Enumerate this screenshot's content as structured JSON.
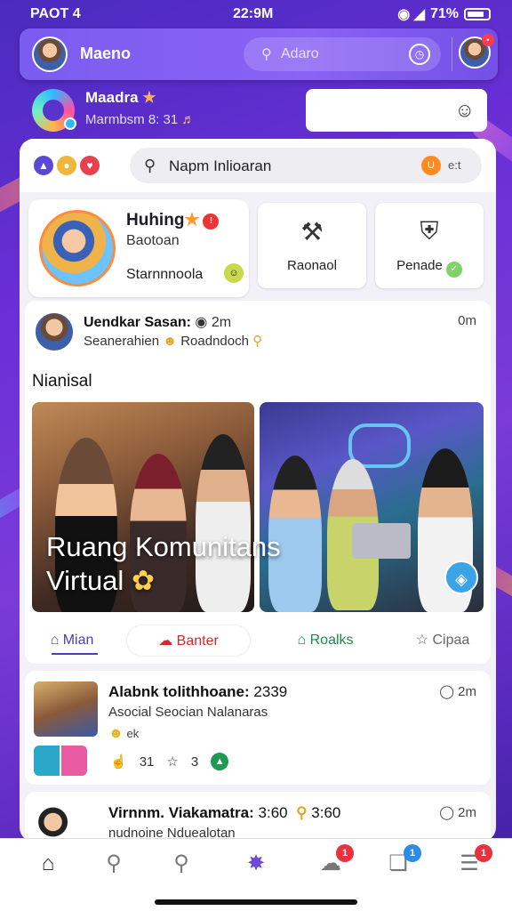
{
  "status_bar": {
    "carrier": "PAOT 4",
    "time": "22:9M",
    "battery": "71%"
  },
  "header": {
    "name": "Maeno",
    "search_placeholder": "Adaro"
  },
  "strip": {
    "name": "Maadra",
    "sub": "Marmbsm 8: 31"
  },
  "search": {
    "placeholder": "Napm Inlioaran",
    "points": "e:t"
  },
  "profile_card": {
    "name": "Huhing",
    "subtitle": "Baotoan",
    "footer": "Starnnnoola"
  },
  "quick_actions": [
    {
      "label": "Raonaol"
    },
    {
      "label": "Penade"
    }
  ],
  "post": {
    "author": "Uendkar Sasan:",
    "meta": "2m",
    "subtitle": "Seanerahien",
    "subtitle_tag": "Roadndoch",
    "time": "0m",
    "caption": "Nianisal",
    "photo_title_1": "Ruang Komunitans",
    "photo_title_2": "Virtual",
    "actions": [
      {
        "label": "Mian"
      },
      {
        "label": "Banter"
      },
      {
        "label": "Roalks"
      },
      {
        "label": "Cipaa"
      }
    ]
  },
  "feed": [
    {
      "title": "Alabnk tolithhoane:",
      "title_num": "2339",
      "subtitle": "Asocial Seocian Nalanaras",
      "extra": "ek",
      "time": "2m",
      "likes": "31",
      "stars": "3"
    },
    {
      "title": "Virnnm. Viakamatra:",
      "title_num": "3:60",
      "extra_num": "3:60",
      "subtitle": "nudnoine Nduealotan",
      "time": "2m"
    }
  ],
  "bottom_nav": [
    {
      "icon": "home-icon"
    },
    {
      "icon": "search-icon"
    },
    {
      "icon": "explore-icon"
    },
    {
      "icon": "create-icon"
    },
    {
      "icon": "chat-icon",
      "badge": "1"
    },
    {
      "icon": "bookmark-icon",
      "badge": "1"
    },
    {
      "icon": "menu-icon",
      "badge": "1"
    }
  ],
  "colors": {
    "accent": "#6b2fd6",
    "header": "#7b5cf0",
    "like": "#d22a2a",
    "share": "#1c8a4d"
  }
}
